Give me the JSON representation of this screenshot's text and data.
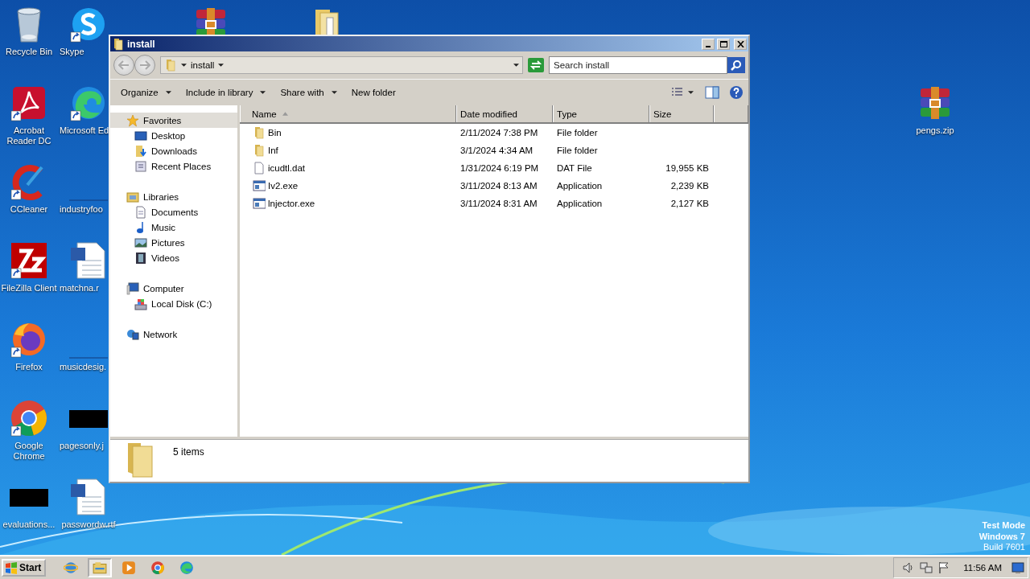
{
  "desktop": {
    "icons": [
      {
        "kind": "recycle-bin",
        "label": "Recycle Bin",
        "shortcut": false
      },
      {
        "kind": "skype",
        "label": "Skype",
        "shortcut": true
      },
      {
        "kind": "archive",
        "shortcut": false
      },
      {
        "kind": "folder",
        "shortcut": false
      },
      {
        "kind": "pdf",
        "label": "Acrobat Reader DC",
        "shortcut": true
      },
      {
        "kind": "edge",
        "label": "Microsoft Ed",
        "shortcut": true
      },
      {
        "kind": "archive",
        "label": "pengs.zip",
        "shortcut": false
      },
      {
        "kind": "cleaner",
        "label": "CCleaner",
        "shortcut": true
      },
      {
        "kind": "blank",
        "label": "industryfoo"
      },
      {
        "kind": "ftp",
        "label": "FileZilla Client",
        "shortcut": true
      },
      {
        "kind": "document",
        "label": "matchna.r",
        "shortcut": false
      },
      {
        "kind": "firefox",
        "label": "Firefox",
        "shortcut": true
      },
      {
        "kind": "blank",
        "label": "musicdesig."
      },
      {
        "kind": "chrome",
        "label": "Google Chrome",
        "shortcut": true
      },
      {
        "kind": "thumbnail",
        "label": "pagesonly.j",
        "shortcut": false
      },
      {
        "kind": "thumbnail",
        "label": "evaluations...",
        "shortcut": false
      },
      {
        "kind": "document",
        "label": "passwordw.rtf",
        "shortcut": false
      }
    ]
  },
  "window": {
    "title": "install",
    "address": {
      "path": "install"
    },
    "search": {
      "placeholder": "Search install"
    },
    "toolbar": [
      {
        "label": "Organize",
        "menu": true
      },
      {
        "label": "Include in library",
        "menu": true
      },
      {
        "label": "Share with",
        "menu": true
      },
      {
        "label": "New folder",
        "menu": false
      }
    ],
    "sidebar": {
      "items": [
        {
          "kind": "star",
          "label": "Favorites",
          "selected": true,
          "children": [
            {
              "kind": "desktop",
              "label": "Desktop",
              "selected": false
            },
            {
              "kind": "downloads",
              "label": "Downloads",
              "selected": false
            },
            {
              "kind": "recent",
              "label": "Recent Places",
              "selected": false
            }
          ]
        },
        {
          "kind": "libraries",
          "label": "Libraries",
          "selected": false,
          "children": [
            {
              "kind": "documents",
              "label": "Documents",
              "selected": false
            },
            {
              "kind": "music",
              "label": "Music",
              "selected": false
            },
            {
              "kind": "pictures",
              "label": "Pictures",
              "selected": false
            },
            {
              "kind": "videos",
              "label": "Videos",
              "selected": false
            }
          ]
        },
        {
          "kind": "computer",
          "label": "Computer",
          "selected": false,
          "children": [
            {
              "kind": "disk",
              "label": "Local Disk (C:)",
              "selected": false
            }
          ]
        },
        {
          "kind": "network",
          "label": "Network",
          "selected": false
        }
      ]
    },
    "table": {
      "columns": [
        {
          "label": "Name",
          "sorted": true
        },
        {
          "label": "Date modified",
          "sorted": false
        },
        {
          "label": "Type",
          "sorted": false
        },
        {
          "label": "Size",
          "sorted": false
        }
      ],
      "rows": [
        {
          "kind": "folder",
          "name": "Bin",
          "date": "2/11/2024 7:38 PM",
          "type": "File folder"
        },
        {
          "kind": "folder",
          "name": "Inf",
          "date": "3/1/2024 4:34 AM",
          "type": "File folder"
        },
        {
          "kind": "file",
          "name": "icudtl.dat",
          "date": "1/31/2024 6:19 PM",
          "type": "DAT File",
          "size": "19,955 KB"
        },
        {
          "kind": "app",
          "name": "Iv2.exe",
          "date": "3/11/2024 8:13 AM",
          "type": "Application",
          "size": "2,239 KB"
        },
        {
          "kind": "app",
          "name": "lnjector.exe",
          "date": "3/11/2024 8:31 AM",
          "type": "Application",
          "size": "2,127 KB"
        }
      ]
    },
    "status": "5 items"
  },
  "watermark": [
    {
      "text": "Test Mode",
      "bold": true
    },
    {
      "text": "Windows 7",
      "bold": true
    },
    {
      "text": "Build 7601",
      "bold": false
    }
  ],
  "taskbar": {
    "start": "Start",
    "apps": [
      {
        "kind": "ie",
        "selected": false
      },
      {
        "kind": "explorer",
        "selected": true
      },
      {
        "kind": "media",
        "selected": false
      },
      {
        "kind": "chrome",
        "selected": false
      },
      {
        "kind": "edge",
        "selected": false
      }
    ],
    "time": "11:56 AM"
  }
}
